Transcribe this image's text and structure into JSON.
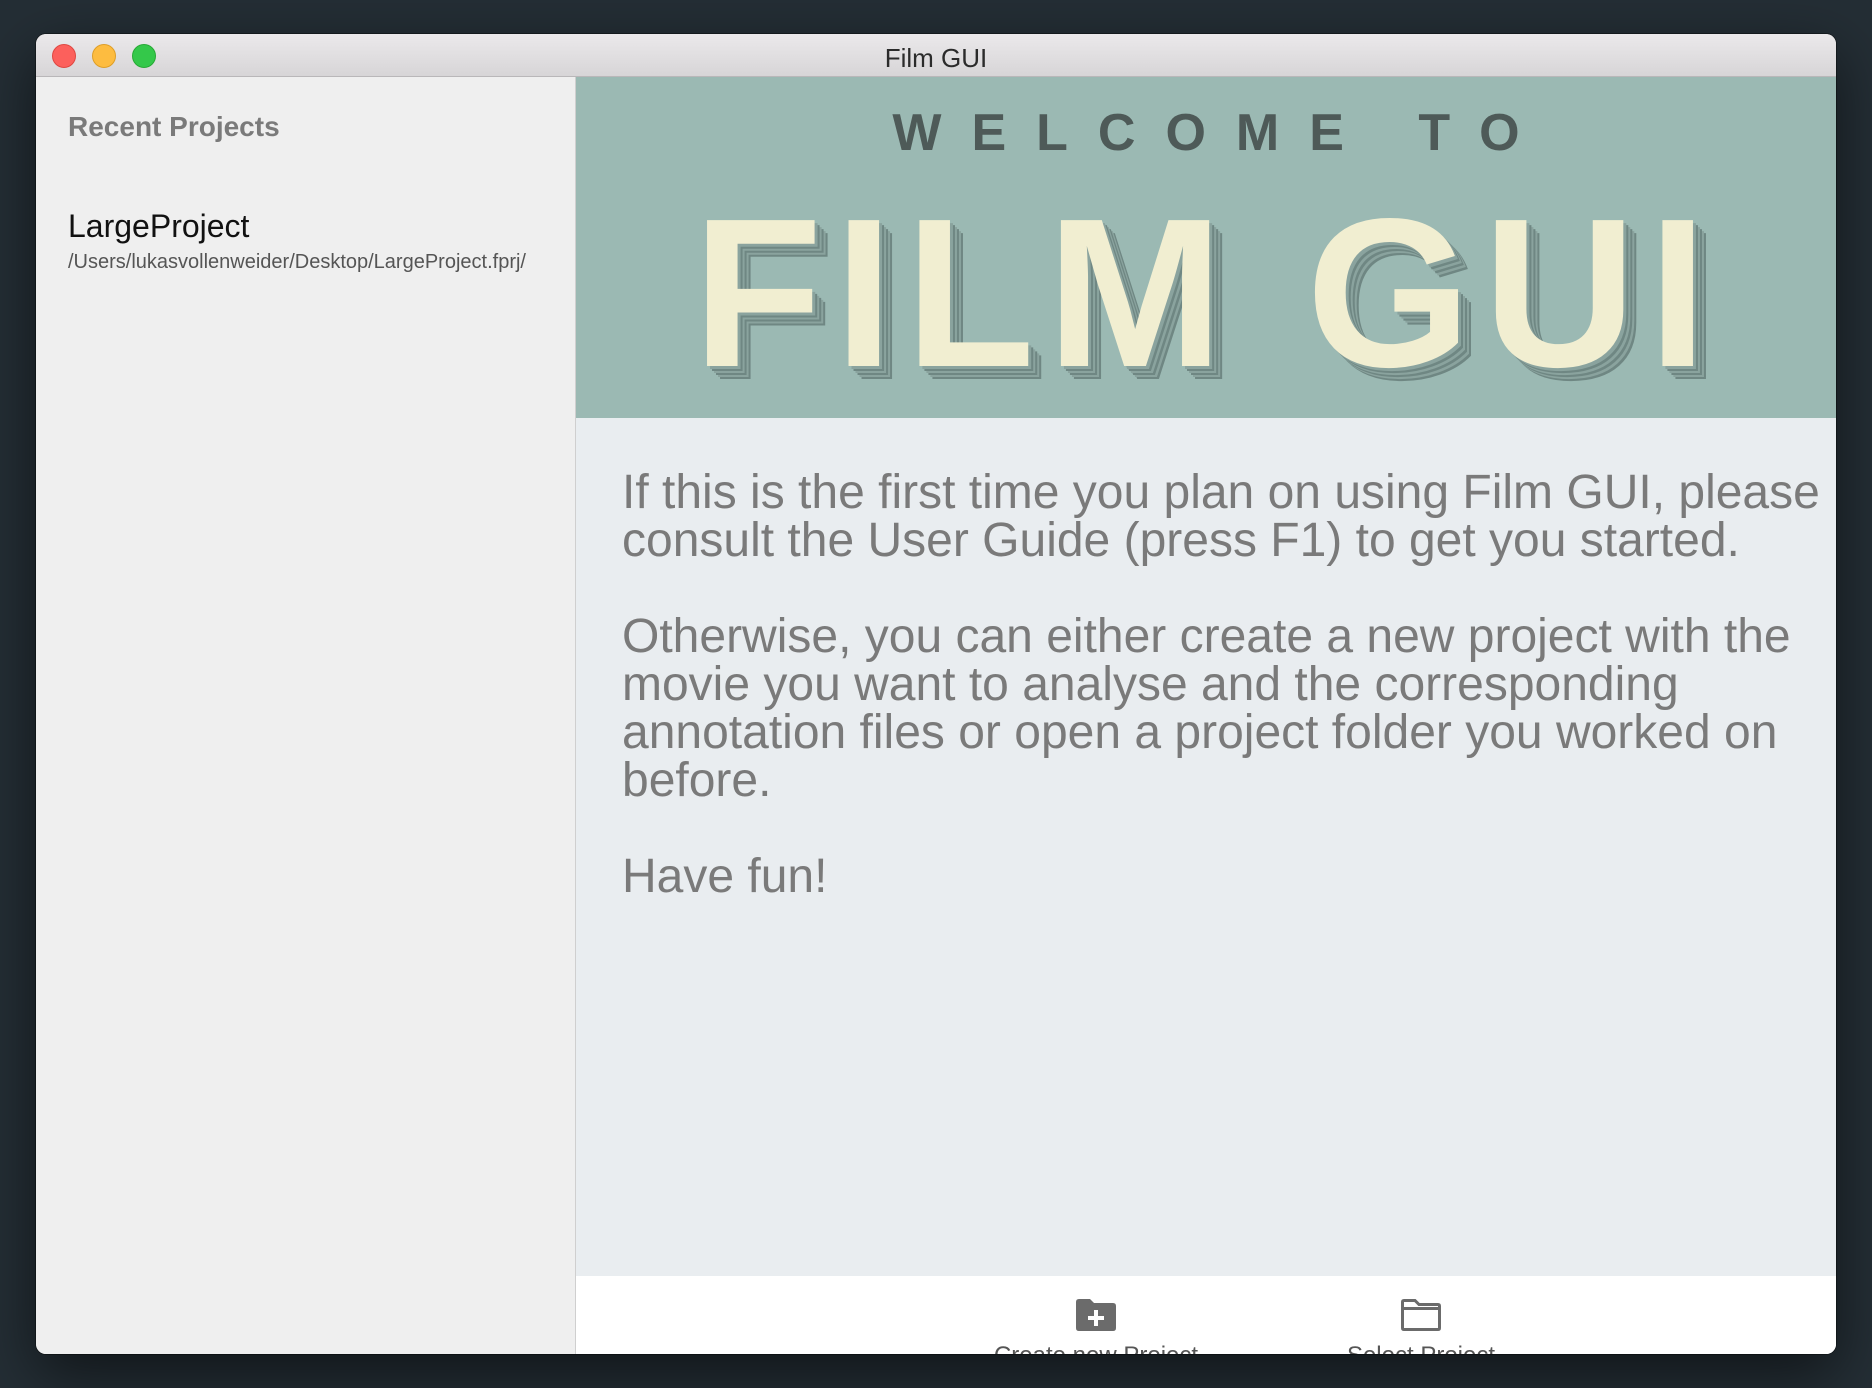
{
  "window": {
    "title": "Film GUI"
  },
  "sidebar": {
    "title": "Recent Projects",
    "projects": [
      {
        "name": "LargeProject",
        "path": "/Users/lukasvollenweider/Desktop/LargeProject.fprj/"
      }
    ]
  },
  "banner": {
    "welcome": "WELCOME TO",
    "title": "FILM GUI"
  },
  "intro": {
    "paragraph1": "If this is the first time you plan on using Film GUI, please consult the User Guide (press F1) to get you started.",
    "paragraph2": "Otherwise, you can either create a new project with the movie you want to analyse and the corresponding annotation files or open a project folder you worked on before.",
    "paragraph3": "Have fun!"
  },
  "footer": {
    "create_label": "Create new Project",
    "create_icon": "folder-plus-icon",
    "select_label": "Select Project",
    "select_icon": "folder-icon"
  },
  "colors": {
    "banner_bg": "#9bb9b3",
    "banner_title": "#f1eed1",
    "body_text": "#7a7a7a"
  }
}
